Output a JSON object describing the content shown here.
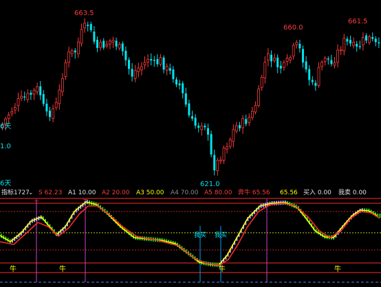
{
  "price_chart": {
    "label_max_left": "663.5",
    "label_max_mid": "660.0",
    "label_max_right": "661.5",
    "label_min": "621.0",
    "label_left_1": "6天",
    "label_left_2": "1.0",
    "label_left_3": "6天",
    "colors": {
      "up": "#ff3b3b",
      "down": "#00e5ee"
    }
  },
  "indicator_bar": {
    "name": "指标1727",
    "dropdown_glyph": "⌄",
    "S": "S 62.23",
    "A1": "A1 10.00",
    "A2": "A2 20.00",
    "A3": "A3 50.00",
    "A4": "A4 70.00",
    "A5": "A5 80.00",
    "bull": "奔牛 65.56",
    "bull_value": "65.56",
    "buy": "买入 0.00",
    "sell": "我卖 0.00"
  },
  "indicator_chart": {
    "signal_bull_labels": [
      "牛",
      "牛",
      "牛",
      "牛"
    ],
    "buy_labels": [
      "我买",
      "我买"
    ],
    "top_marks": [
      "一",
      "一"
    ],
    "colors": {
      "yellow": "#ffff00",
      "red": "#ff2a2a",
      "green": "#22cc22",
      "lavender": "#a0a0ff",
      "cyan": "#00e5ee",
      "magenta": "#cc44cc"
    }
  }
}
